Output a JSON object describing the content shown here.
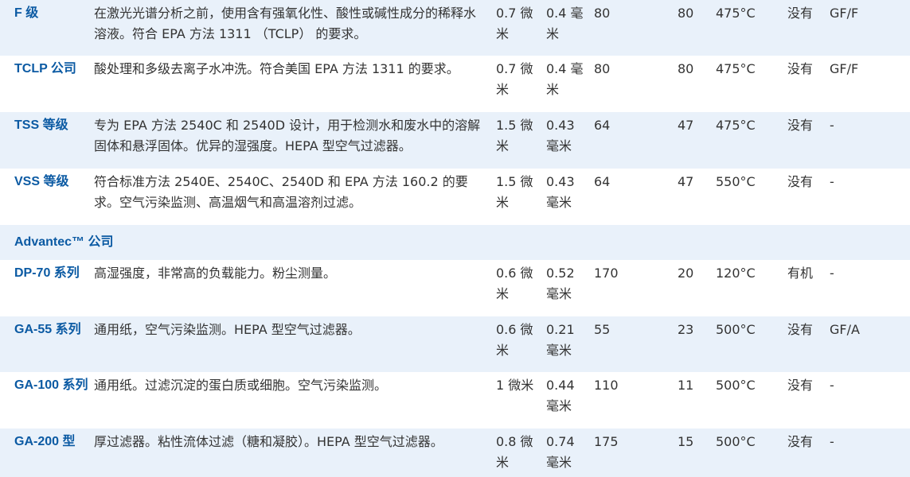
{
  "rows": [
    {
      "kind": "data",
      "name": "F 级",
      "desc": "在激光光谱分析之前，使用含有强氧化性、酸性或碱性成分的稀释水溶液。符合 EPA 方法 1311 （TCLP） 的要求。",
      "retention": "0.7 微米",
      "thickness": "0.4 毫米",
      "c3": "80",
      "c4": "80",
      "temp": "475°C",
      "binder": "没有",
      "equiv": "GF/F"
    },
    {
      "kind": "data",
      "name": "TCLP 公司",
      "desc": "酸处理和多级去离子水冲洗。符合美国 EPA 方法 1311 的要求。",
      "retention": "0.7 微米",
      "thickness": "0.4 毫米",
      "c3": "80",
      "c4": "80",
      "temp": "475°C",
      "binder": "没有",
      "equiv": "GF/F"
    },
    {
      "kind": "data",
      "name": "TSS 等级",
      "desc": "专为 EPA 方法 2540C 和 2540D 设计，用于检测水和废水中的溶解固体和悬浮固体。优异的湿强度。HEPA 型空气过滤器。",
      "retention": "1.5 微米",
      "thickness": "0.43 毫米",
      "c3": "64",
      "c4": "47",
      "temp": "475°C",
      "binder": "没有",
      "equiv": "-"
    },
    {
      "kind": "data",
      "name": "VSS 等级",
      "desc": "符合标准方法 2540E、2540C、2540D 和 EPA 方法 160.2 的要求。空气污染监测、高温烟气和高温溶剂过滤。",
      "retention": "1.5 微米",
      "thickness": "0.43 毫米",
      "c3": "64",
      "c4": "47",
      "temp": "550°C",
      "binder": "没有",
      "equiv": "-"
    },
    {
      "kind": "group",
      "name": "Advantec™ 公司"
    },
    {
      "kind": "data",
      "name": "DP-70 系列",
      "desc": "高湿强度，非常高的负载能力。粉尘测量。",
      "retention": "0.6 微米",
      "thickness": "0.52 毫米",
      "c3": "170",
      "c4": "20",
      "temp": "120°C",
      "binder": "有机",
      "equiv": "-"
    },
    {
      "kind": "data",
      "name": "GA-55 系列",
      "desc": "通用纸，空气污染监测。HEPA 型空气过滤器。",
      "retention": "0.6 微米",
      "thickness": "0.21 毫米",
      "c3": "55",
      "c4": "23",
      "temp": "500°C",
      "binder": "没有",
      "equiv": "GF/A"
    },
    {
      "kind": "data",
      "name": "GA-100 系列",
      "desc": "通用纸。过滤沉淀的蛋白质或细胞。空气污染监测。",
      "retention": "1 微米",
      "thickness": "0.44 毫米",
      "c3": "110",
      "c4": "11",
      "temp": "500°C",
      "binder": "没有",
      "equiv": "-"
    },
    {
      "kind": "data",
      "name": "GA-200 型",
      "desc": "厚过滤器。粘性流体过滤（糖和凝胶）。HEPA 型空气过滤器。",
      "retention": "0.8 微米",
      "thickness": "0.74 毫米",
      "c3": "175",
      "c4": "15",
      "temp": "500°C",
      "binder": "没有",
      "equiv": "-"
    }
  ]
}
